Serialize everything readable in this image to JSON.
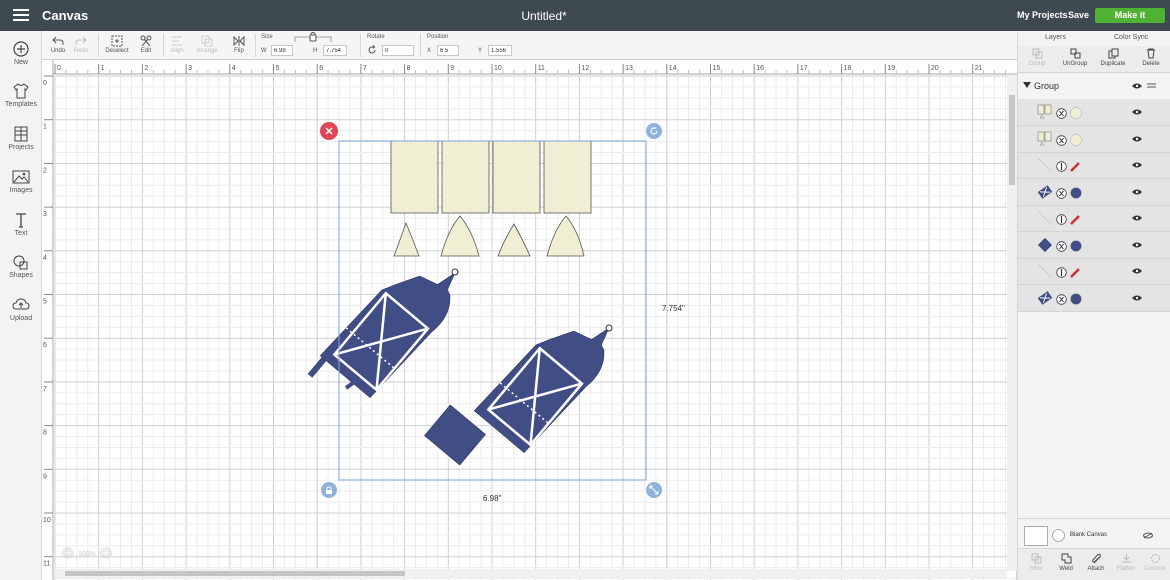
{
  "header": {
    "app_name": "Canvas",
    "doc_title": "Untitled*",
    "my_projects": "My Projects",
    "save": "Save",
    "make": "Make it"
  },
  "sidebar": {
    "items": [
      {
        "label": "New",
        "icon": "plus-circle-icon"
      },
      {
        "label": "Templates",
        "icon": "tshirt-icon"
      },
      {
        "label": "Projects",
        "icon": "projects-grid-icon"
      },
      {
        "label": "Images",
        "icon": "image-icon"
      },
      {
        "label": "Text",
        "icon": "text-t-icon"
      },
      {
        "label": "Shapes",
        "icon": "shapes-icon"
      },
      {
        "label": "Upload",
        "icon": "cloud-upload-icon"
      }
    ]
  },
  "toolbar": {
    "undo": "Undo",
    "redo": "Redo",
    "deselect": "Deselect",
    "edit": "Edit",
    "align": "Align",
    "arrange": "Arrange",
    "flip": "Flip",
    "size_label": "Size",
    "w_label": "W",
    "w_value": "6.98",
    "h_label": "H",
    "h_value": "7.754",
    "rotate_label": "Rotate",
    "rotate_value": "0",
    "position_label": "Position",
    "x_label": "X",
    "x_value": "6.5",
    "y_label": "Y",
    "y_value": "1.556"
  },
  "canvas": {
    "ruler_top": [
      "0",
      "1",
      "2",
      "3",
      "4",
      "5",
      "6",
      "7",
      "8",
      "9",
      "10",
      "11",
      "12",
      "13",
      "14",
      "15",
      "16",
      "17",
      "18",
      "19",
      "20",
      "21"
    ],
    "ruler_left": [
      "0",
      "1",
      "2",
      "3",
      "4",
      "5",
      "6",
      "7",
      "8",
      "9",
      "10",
      "11"
    ],
    "height_dim": "7.754\"",
    "width_dim": "6.98\"",
    "zoom": "100%",
    "colors": {
      "cream": "#f0efd3",
      "navy": "#414d85",
      "selection": "#7ba6d6",
      "delete": "#e04658"
    }
  },
  "panel": {
    "tab_layers": "Layers",
    "tab_color_sync": "Color Sync",
    "actions": [
      {
        "label": "Group",
        "enabled": false
      },
      {
        "label": "UnGroup",
        "enabled": true
      },
      {
        "label": "Duplicate",
        "enabled": true
      },
      {
        "label": "Delete",
        "enabled": true
      }
    ],
    "group_label": "Group",
    "layers": [
      {
        "thumb": "cream-rect",
        "color": "#f0efd3"
      },
      {
        "thumb": "cream-rect",
        "color": "#f0efd3"
      },
      {
        "thumb": "score-line",
        "color": "#d03030"
      },
      {
        "thumb": "navy-piece",
        "color": "#414d85"
      },
      {
        "thumb": "score-line",
        "color": "#d03030"
      },
      {
        "thumb": "navy-diamond",
        "color": "#414d85"
      },
      {
        "thumb": "score-line",
        "color": "#d03030"
      },
      {
        "thumb": "navy-piece",
        "color": "#414d85"
      }
    ],
    "blank_canvas": "Blank Canvas",
    "bottom_actions": [
      {
        "label": "Slice",
        "enabled": false
      },
      {
        "label": "Weld",
        "enabled": true
      },
      {
        "label": "Attach",
        "enabled": true
      },
      {
        "label": "Flatten",
        "enabled": false
      },
      {
        "label": "Contour",
        "enabled": false
      }
    ]
  }
}
